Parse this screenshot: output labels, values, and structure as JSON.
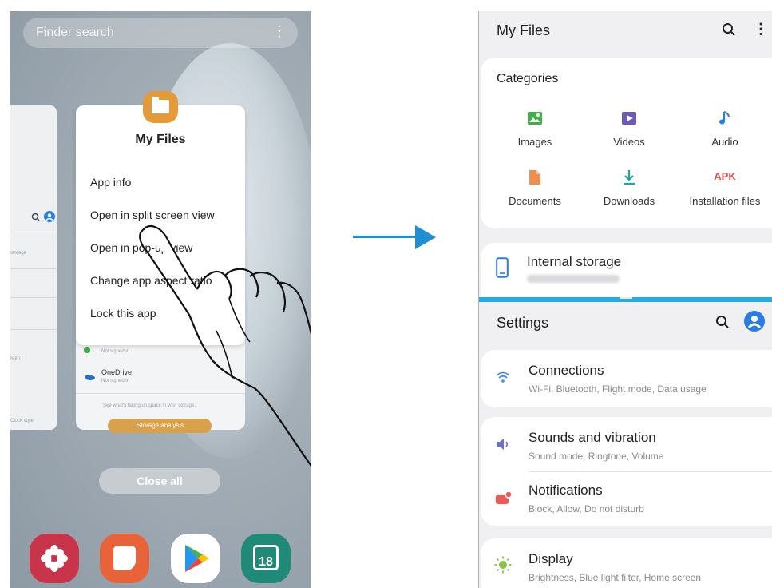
{
  "recents": {
    "search_placeholder": "Finder search",
    "menu": {
      "title": "My Files",
      "items": [
        "App info",
        "Open in split screen view",
        "Open in pop-up view",
        "Change app aspect ratio",
        "Lock this app"
      ]
    },
    "behind_card": {
      "row1_sub": "Not signed in",
      "row2_title": "OneDrive",
      "row2_sub": "Not signed in",
      "hint": "See what's taking up space in your storage.",
      "button": "Storage analysis"
    },
    "left_card_labels": [
      "storage",
      "reen",
      "Clock style"
    ],
    "close_all": "Close all",
    "dock": {
      "calendar_day": "18"
    }
  },
  "my_files": {
    "title": "My Files",
    "categories_header": "Categories",
    "categories": [
      {
        "label": "Images",
        "icon": "image-icon",
        "color": "#3fae49"
      },
      {
        "label": "Videos",
        "icon": "video-icon",
        "color": "#6b5bb5"
      },
      {
        "label": "Audio",
        "icon": "music-note-icon",
        "color": "#2a7de1"
      },
      {
        "label": "Documents",
        "icon": "document-icon",
        "color": "#ef8f4f"
      },
      {
        "label": "Downloads",
        "icon": "download-icon",
        "color": "#19a7a0"
      },
      {
        "label": "Installation files",
        "icon": "apk-icon",
        "apk_text": "APK",
        "color": "#e0504a"
      }
    ],
    "internal_storage": "Internal storage"
  },
  "settings": {
    "title": "Settings",
    "items": [
      {
        "title": "Connections",
        "subtitle": "Wi-Fi, Bluetooth, Flight mode, Data usage",
        "icon": "wifi-icon",
        "color": "#4c8bd6"
      },
      {
        "title": "Sounds and vibration",
        "subtitle": "Sound mode, Ringtone, Volume",
        "icon": "volume-icon",
        "color": "#6b6fd0"
      },
      {
        "title": "Notifications",
        "subtitle": "Block, Allow, Do not disturb",
        "icon": "notification-icon",
        "color": "#ea5a57"
      },
      {
        "title": "Display",
        "subtitle": "Brightness, Blue light filter, Home screen",
        "icon": "sun-icon",
        "color": "#8bc34a"
      }
    ]
  },
  "colors": {
    "arrow": "#1e8fd3",
    "accent_blue": "#2a7de1",
    "split_bar": "#29a9e1"
  }
}
